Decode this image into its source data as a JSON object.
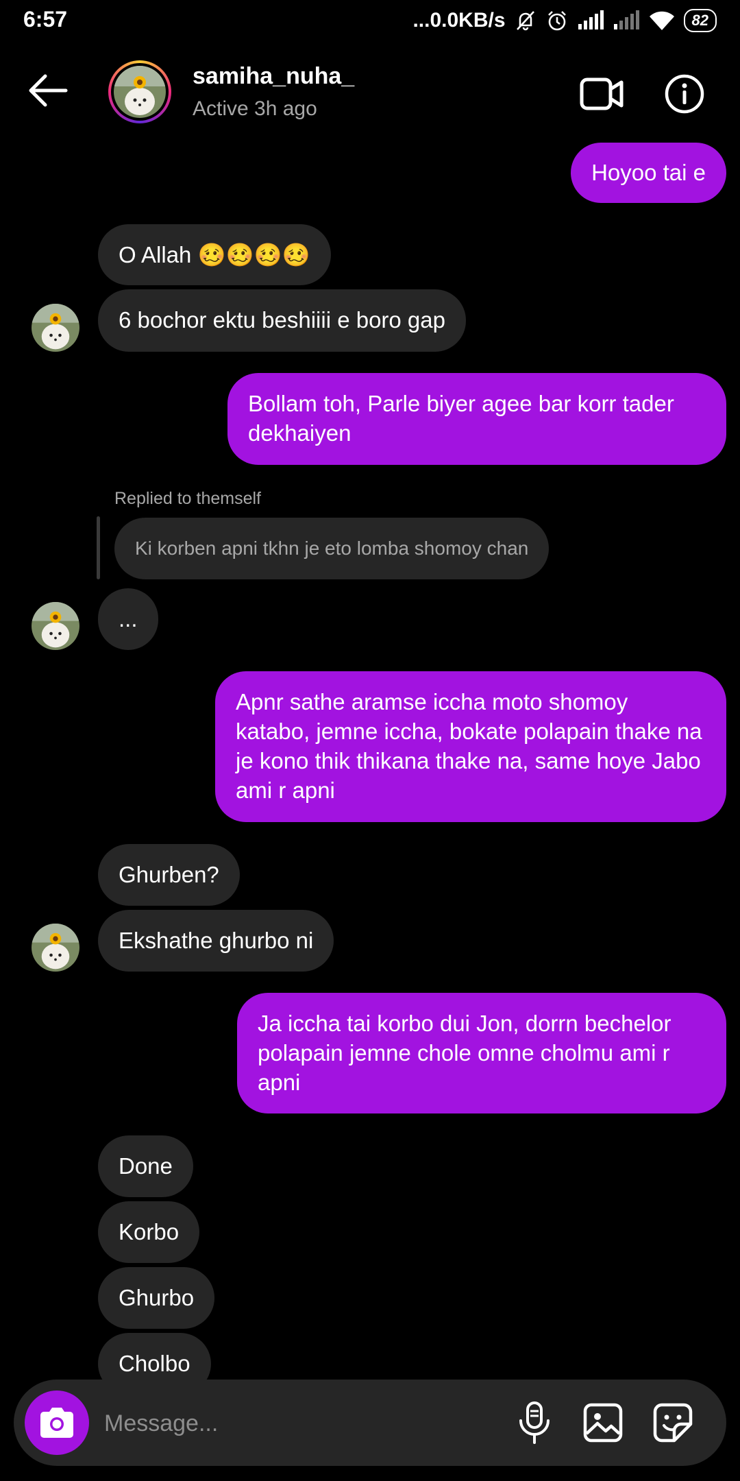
{
  "status_bar": {
    "time": "6:57",
    "speed": "...0.0KB/s",
    "battery": "82"
  },
  "header": {
    "username": "samiha_nuha_",
    "active_status": "Active 3h ago"
  },
  "messages": [
    {
      "from": "me",
      "text": "Hoyoo tai e"
    },
    {
      "from": "them",
      "text": "O Allah 🥴🥴🥴🥴"
    },
    {
      "from": "them",
      "text": "6 bochor ektu beshiiii e boro gap"
    },
    {
      "from": "me",
      "text": "Bollam toh, Parle biyer agee bar korr tader dekhaiyen"
    },
    {
      "from": "them",
      "reply_label": "Replied to themself",
      "reply_quote": "Ki korben apni tkhn je eto lomba shomoy chan",
      "text": "..."
    },
    {
      "from": "me",
      "text": "Apnr sathe aramse iccha moto shomoy katabo, jemne iccha, bokate polapain thake na je kono thik thikana thake na, same hoye Jabo ami r apni"
    },
    {
      "from": "them",
      "text": "Ghurben?"
    },
    {
      "from": "them",
      "text": "Ekshathe ghurbo ni"
    },
    {
      "from": "me",
      "text": "Ja iccha tai korbo dui Jon, dorrn bechelor polapain jemne chole omne cholmu ami r apni"
    },
    {
      "from": "them",
      "text": "Done"
    },
    {
      "from": "them",
      "text": "Korbo"
    },
    {
      "from": "them",
      "text": "Ghurbo"
    },
    {
      "from": "them",
      "text": "Cholbo"
    }
  ],
  "composer": {
    "placeholder": "Message..."
  },
  "colors": {
    "outgoing_bubble": "#a213e0",
    "incoming_bubble": "#262626",
    "background": "#000000"
  }
}
